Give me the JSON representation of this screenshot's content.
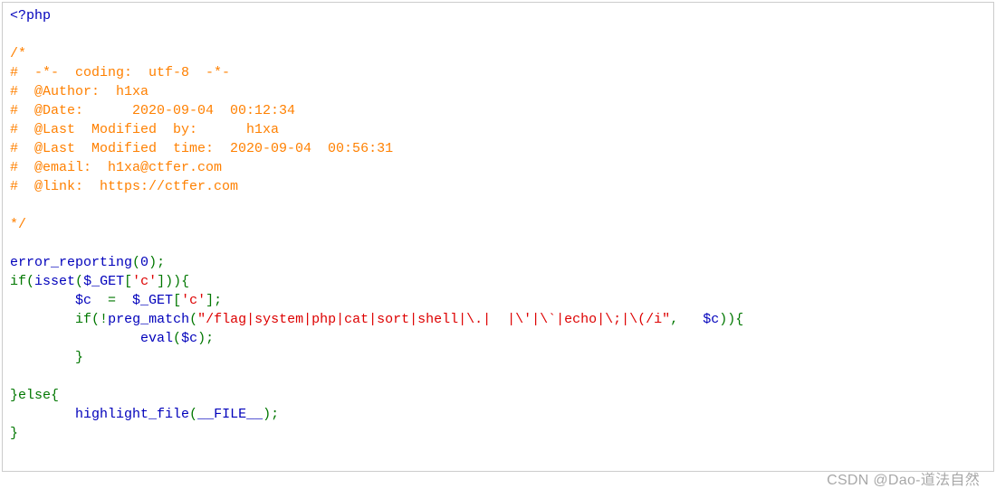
{
  "php_open": "<?php",
  "comment": {
    "open": "/*",
    "l1": "#  -*-  coding:  utf-8  -*-",
    "l2": "#  @Author:  h1xa",
    "l3": "#  @Date:      2020-09-04  00:12:34",
    "l4": "#  @Last  Modified  by:      h1xa",
    "l5": "#  @Last  Modified  time:  2020-09-04  00:56:31",
    "l6": "#  @email:  h1xa@ctfer.com",
    "l7": "#  @link:  https://ctfer.com",
    "close": "*/"
  },
  "code": {
    "err": "error_reporting",
    "zero": "0",
    "if": "if",
    "isset": "isset",
    "get": "$_GET",
    "idx": "'c'",
    "cvar": "$c",
    "eq": "  =  ",
    "not": "!",
    "preg": "preg_match",
    "re": "\"/flag|system|php|cat|sort|shell|\\.|  |\\'|\\`|echo|\\;|\\(/i\"",
    "comma": ",   ",
    "eval": "eval",
    "else": "else",
    "hl": "highlight_file",
    "file": "__FILE__",
    "semi": ";",
    "op": "(",
    "cp": ")",
    "ob": "{",
    "cb": "}",
    "osq": "[",
    "csq": "]"
  },
  "indent1": "        ",
  "indent2": "                ",
  "watermark": "CSDN @Dao-道法自然"
}
